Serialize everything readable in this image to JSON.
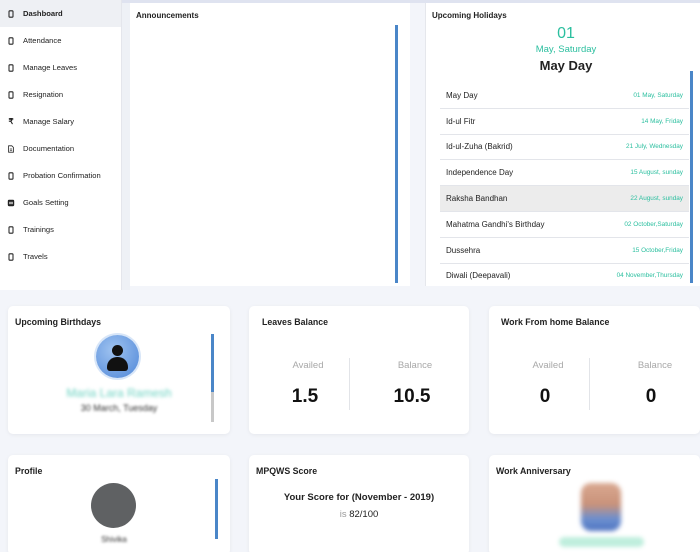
{
  "sidebar": {
    "items": [
      {
        "label": "Dashboard",
        "icon": "square-icon",
        "active": true
      },
      {
        "label": "Attendance",
        "icon": "square-icon"
      },
      {
        "label": "Manage Leaves",
        "icon": "square-icon"
      },
      {
        "label": "Resignation",
        "icon": "square-icon"
      },
      {
        "label": "Manage Salary",
        "icon": "rupee-icon"
      },
      {
        "label": "Documentation",
        "icon": "document-icon"
      },
      {
        "label": "Probation Confirmation",
        "icon": "square-icon"
      },
      {
        "label": "Goals Setting",
        "icon": "goals-icon"
      },
      {
        "label": "Trainings",
        "icon": "square-icon"
      },
      {
        "label": "Travels",
        "icon": "square-icon"
      }
    ]
  },
  "announcements": {
    "title": "Announcements"
  },
  "holidays": {
    "title": "Upcoming Holidays",
    "featured_date": "01",
    "featured_day": "May, Saturday",
    "featured_name": "May Day",
    "list": [
      {
        "name": "May Day",
        "date": "01 May, Saturday"
      },
      {
        "name": "Id-ul Fitr",
        "date": "14 May, Friday"
      },
      {
        "name": "Id-ul-Zuha (Bakrid)",
        "date": "21 July, Wednesday"
      },
      {
        "name": "Independence Day",
        "date": "15 August, sunday"
      },
      {
        "name": "Raksha Bandhan",
        "date": "22 August, sunday"
      },
      {
        "name": "Mahatma Gandhi's Birthday",
        "date": "02 October,Saturday"
      },
      {
        "name": "Dussehra",
        "date": "15 October,Friday"
      },
      {
        "name": "Diwali (Deepavali)",
        "date": "04 November,Thursday"
      }
    ]
  },
  "birthdays": {
    "title": "Upcoming Birthdays",
    "name": "Maria Lara Ramesh",
    "date": "30 March, Tuesday"
  },
  "leaves": {
    "title": "Leaves Balance",
    "availed_label": "Availed",
    "balance_label": "Balance",
    "availed": "1.5",
    "balance": "10.5"
  },
  "wfh": {
    "title": "Work From home Balance",
    "availed_label": "Availed",
    "balance_label": "Balance",
    "availed": "0",
    "balance": "0"
  },
  "profile": {
    "title": "Profile",
    "name": "Shivika"
  },
  "score": {
    "title": "MPQWS Score",
    "line": "Your Score for (November - 2019)",
    "is_label": "is",
    "value": "82/100"
  },
  "anniversary": {
    "title": "Work Anniversary"
  },
  "colors": {
    "accent": "#2bbf9f",
    "scrollbar": "#4a86c8"
  }
}
